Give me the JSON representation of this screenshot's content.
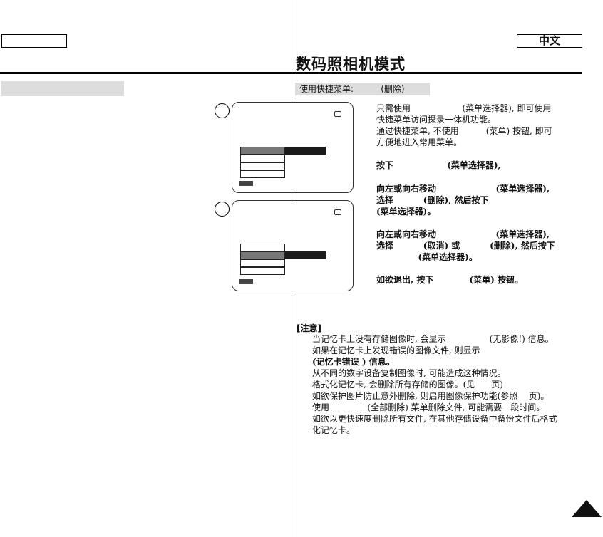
{
  "header": {
    "lang_left": "",
    "lang_right": "中文",
    "title": "数码照相机模式"
  },
  "section_bar": {
    "left": "",
    "right": "使用快捷菜单:          (删除)"
  },
  "steps": [
    "",
    ""
  ],
  "instructions": [
    "只需使用                   (菜单选择器), 即可使用",
    "快捷菜单访问摄录一体机功能。",
    "通过快捷菜单, 不使用          (菜单) 按钮, 即可",
    "方便地进入常用菜单。",
    "按下                  (菜单选择器),",
    "向左或向右移动                    (菜单选择器),",
    "选择          (删除), 然后按下",
    "(菜单选择器)。",
    "向左或向右移动                    (菜单选择器),",
    "选择          (取消) 或          (删除), 然后按下",
    "              (菜单选择器)。",
    "如欲退出, 按下            (菜单) 按钮。"
  ],
  "notes": {
    "heading": "[注意]",
    "lines": [
      "当记忆卡上没有存储图像时, 会显示                (无影像!) 信息。",
      "如果在记忆卡上发现错误的图像文件, 则显示",
      "(记忆卡错误 ) 信息。",
      "从不同的数字设备复制图像时, 可能造成这种情况。",
      "格式化记忆卡, 会删除所有存储的图像。(见      页)",
      "如欲保护图片防止意外删除, 则启用图像保护功能(参照    页)。",
      "使用              (全部删除) 菜单删除文件, 可能需要一段时间。",
      "如欲以更快速度删除所有文件, 在其他存储设备中备份文件后格式",
      "化记忆卡。"
    ]
  },
  "colors": {
    "rule": "#000000",
    "bar_bg": "#dddddd",
    "menu_selected": "#777777",
    "menu_extension": "#1a1a1a"
  },
  "icons": {
    "page_corner": "triangle-up-icon",
    "screen_card": "memory-card-icon"
  }
}
